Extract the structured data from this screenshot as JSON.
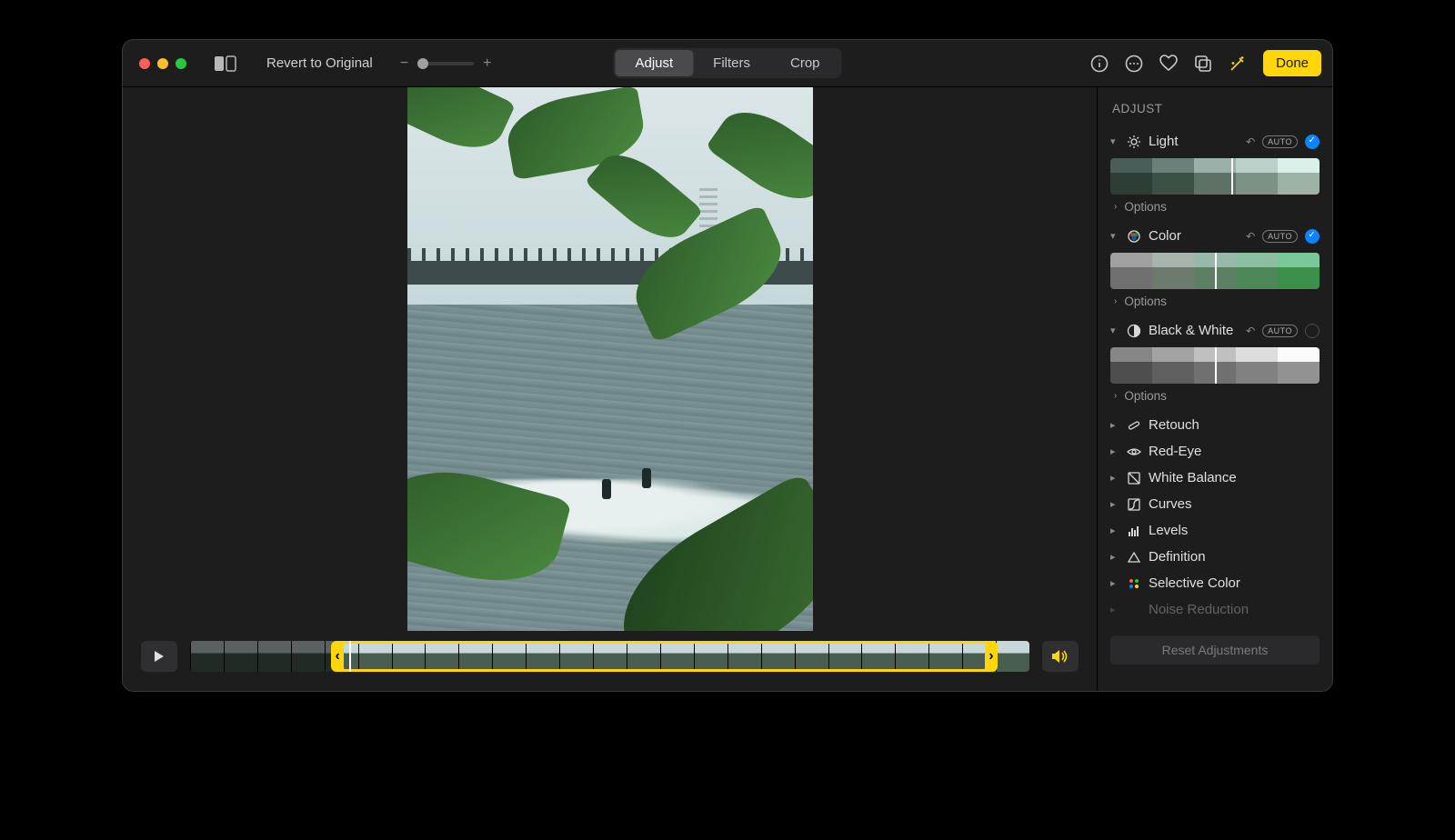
{
  "toolbar": {
    "revert_label": "Revert to Original",
    "tabs": {
      "adjust": "Adjust",
      "filters": "Filters",
      "crop": "Crop"
    },
    "done_label": "Done",
    "auto_label": "AUTO"
  },
  "sidebar": {
    "title": "ADJUST",
    "sections": {
      "light": {
        "label": "Light",
        "options": "Options",
        "active": true
      },
      "color": {
        "label": "Color",
        "options": "Options",
        "active": true
      },
      "bw": {
        "label": "Black & White",
        "options": "Options",
        "active": false
      },
      "retouch": {
        "label": "Retouch"
      },
      "redeye": {
        "label": "Red-Eye"
      },
      "wb": {
        "label": "White Balance"
      },
      "curves": {
        "label": "Curves"
      },
      "levels": {
        "label": "Levels"
      },
      "definition": {
        "label": "Definition"
      },
      "selcolor": {
        "label": "Selective Color"
      },
      "noise": {
        "label": "Noise Reduction"
      }
    },
    "reset_label": "Reset Adjustments"
  }
}
